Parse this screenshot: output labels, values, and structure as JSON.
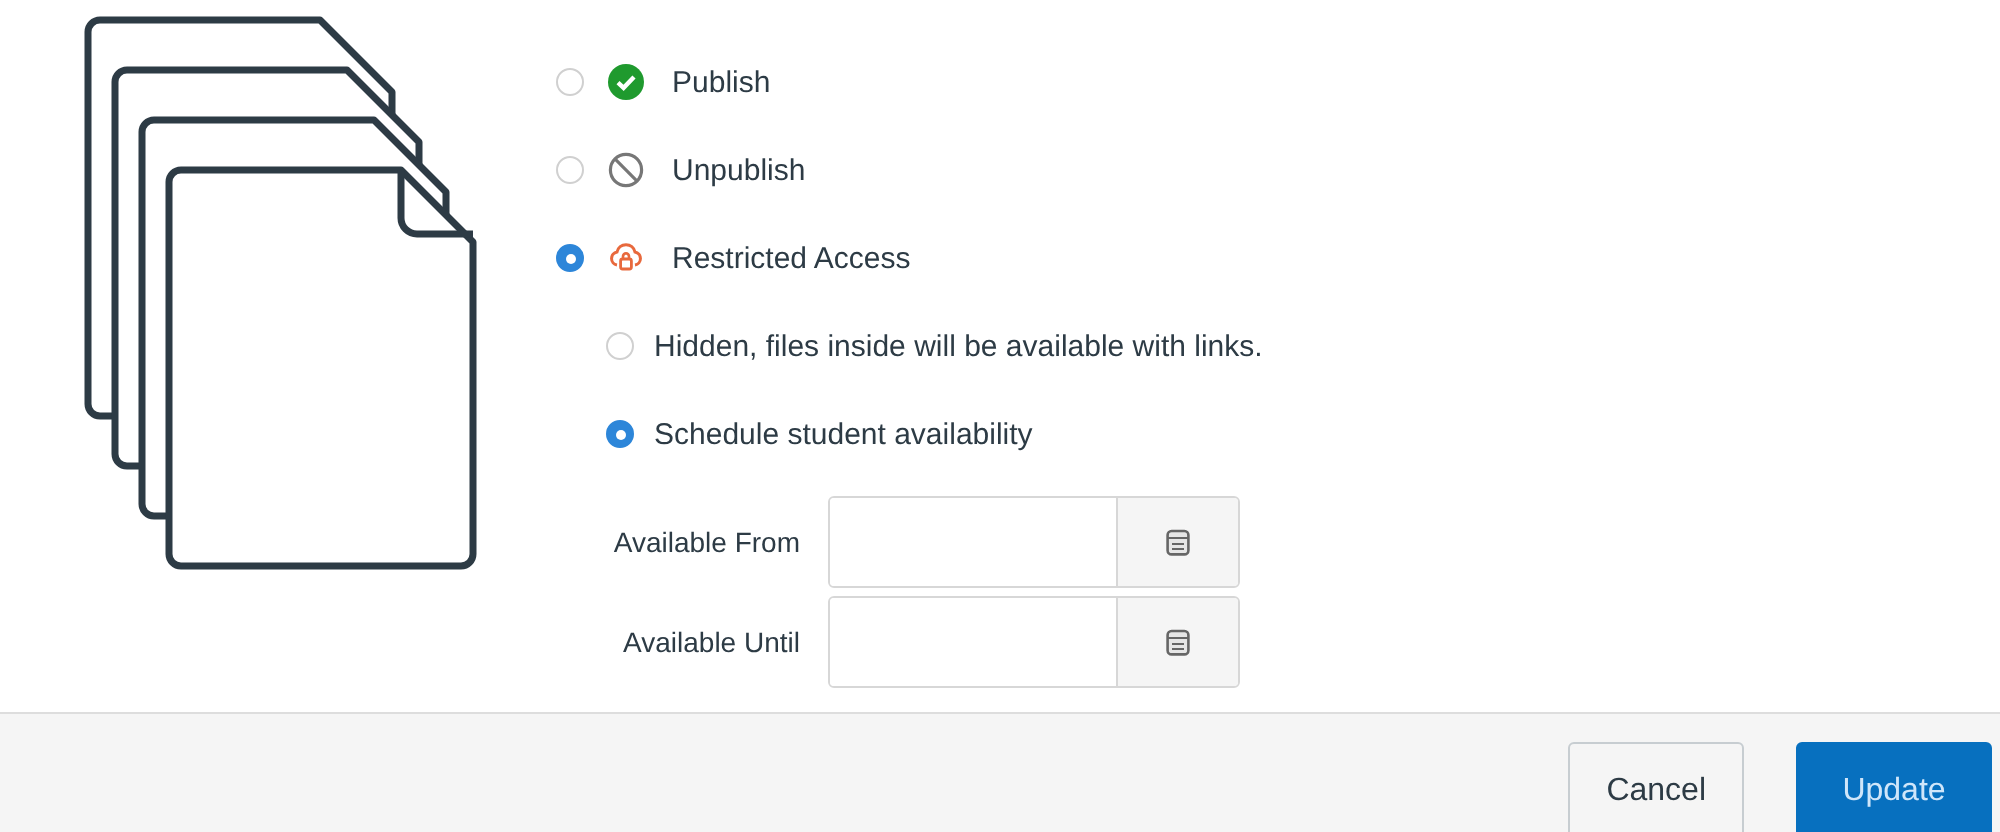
{
  "options": [
    {
      "label": "Publish",
      "kind": "published",
      "selected": false
    },
    {
      "label": "Unpublish",
      "kind": "unpublished",
      "selected": false
    },
    {
      "label": "Restricted Access",
      "kind": "restricted",
      "selected": true
    }
  ],
  "restricted_options": [
    {
      "label": "Hidden, files inside will be available with links.",
      "selected": false
    },
    {
      "label": "Schedule student availability",
      "selected": true
    }
  ],
  "date_fields": [
    {
      "label": "Available From"
    },
    {
      "label": "Available Until"
    }
  ],
  "buttons": [
    {
      "label": "Cancel",
      "kind": "secondary"
    },
    {
      "label": "Update",
      "kind": "primary"
    }
  ]
}
